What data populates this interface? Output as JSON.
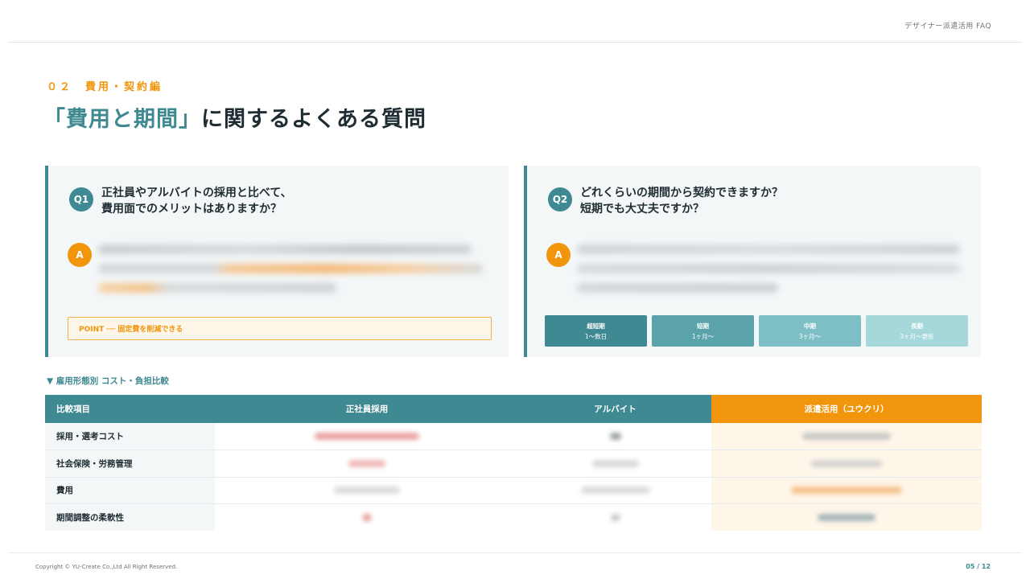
{
  "header": {
    "title": "デザイナー派遣活用 FAQ"
  },
  "section": {
    "label": "０２　費用・契約編",
    "headline_highlight": "「費用と期間」",
    "headline_rest": "に関するよくある質問"
  },
  "faq": [
    {
      "badge": "Q1",
      "question_line1": "正社員やアルバイトの採用と比べて、",
      "question_line2": "費用面でのメリットはありますか？",
      "answer_badge": "A",
      "point": "POINT ── 固定費を削減できる"
    },
    {
      "badge": "Q2",
      "question_line1": "どれくらいの期間から契約できますか？",
      "question_line2": "短期でも大丈夫ですか？",
      "answer_badge": "A",
      "periods": [
        {
          "label": "超短期",
          "range": "1〜数日",
          "color": "#3f8a92"
        },
        {
          "label": "短期",
          "range": "1ヶ月〜",
          "color": "#5aa3aa"
        },
        {
          "label": "中期",
          "range": "3ヶ月〜",
          "color": "#7dbfc4"
        },
        {
          "label": "長期",
          "range": "3ヶ月〜更新",
          "color": "#a6d8db"
        }
      ]
    }
  ],
  "table": {
    "title": "▼ 雇用形態別 コスト・負担比較",
    "headers": [
      "比較項目",
      "正社員採用",
      "アルバイト",
      "派遣活用（ユウクリ）"
    ],
    "rows": [
      {
        "label": "採用・選考コスト"
      },
      {
        "label": "社会保険・労務管理"
      },
      {
        "label": "費用"
      },
      {
        "label": "期間調整の柔軟性"
      }
    ]
  },
  "footer": {
    "copyright": "Copyright © YU-Create Co.,Ltd All Right Reserved.",
    "page": "05 / 12"
  },
  "colors": {
    "teal": "#3f8a92",
    "orange": "#f0950c",
    "panel": "#f3f7f8"
  },
  "icons": {
    "table_marker": "triangle-down-icon"
  }
}
